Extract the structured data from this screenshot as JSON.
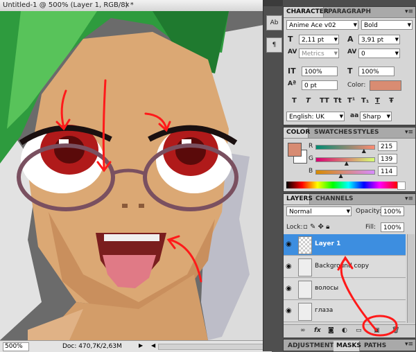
{
  "document": {
    "title": "Untitled-1 @ 500% (Layer 1, RGB/8) *",
    "close_glyph": "×",
    "zoom": "500%",
    "doc_info": "Doc: 470,7K/2,63M"
  },
  "icon_strip": {
    "buttons": [
      "character-panel-icon",
      "paragraph-panel-icon"
    ]
  },
  "character_panel": {
    "tabs": [
      "CHARACTER",
      "PARAGRAPH"
    ],
    "font_family": "Anime Ace v02",
    "font_style": "Bold",
    "font_size": "2,11 pt",
    "leading": "3,91 pt",
    "kerning": "Metrics",
    "tracking": "0",
    "vertical_scale": "100%",
    "horizontal_scale": "100%",
    "baseline_shift": "0 pt",
    "color_label": "Color:",
    "color": "#d98c72",
    "style_buttons": [
      "T",
      "T",
      "TT",
      "Tt",
      "T¹",
      "T₁",
      "T",
      "Ŧ"
    ],
    "language": "English: UK",
    "aa_label": "aa",
    "antialias": "Sharp"
  },
  "color_panel": {
    "tabs": [
      "COLOR",
      "SWATCHES",
      "STYLES"
    ],
    "channels": [
      {
        "name": "R",
        "value": "215"
      },
      {
        "name": "G",
        "value": "139"
      },
      {
        "name": "B",
        "value": "114"
      }
    ],
    "levels": [
      0.843,
      0.545,
      0.447
    ],
    "fg": "#d78b72",
    "bg": "#ffffff"
  },
  "layers_panel": {
    "tabs": [
      "LAYERS",
      "CHANNELS"
    ],
    "blend_mode": "Normal",
    "opacity_label": "Opacity:",
    "opacity": "100%",
    "lock_label": "Lock:",
    "fill_label": "Fill:",
    "fill": "100%",
    "layers": [
      {
        "name": "Layer 1",
        "selected": true
      },
      {
        "name": "Background copy",
        "selected": false
      },
      {
        "name": "волосы",
        "selected": false
      },
      {
        "name": "глаза",
        "selected": false
      }
    ],
    "footer_buttons": [
      "link",
      "fx",
      "mask",
      "adjust",
      "folder",
      "new",
      "trash"
    ]
  },
  "bottom_tabs": {
    "tabs": [
      "ADJUSTMENTS",
      "MASKS",
      "PATHS"
    ]
  },
  "annotation_color": "#ff1a1a"
}
